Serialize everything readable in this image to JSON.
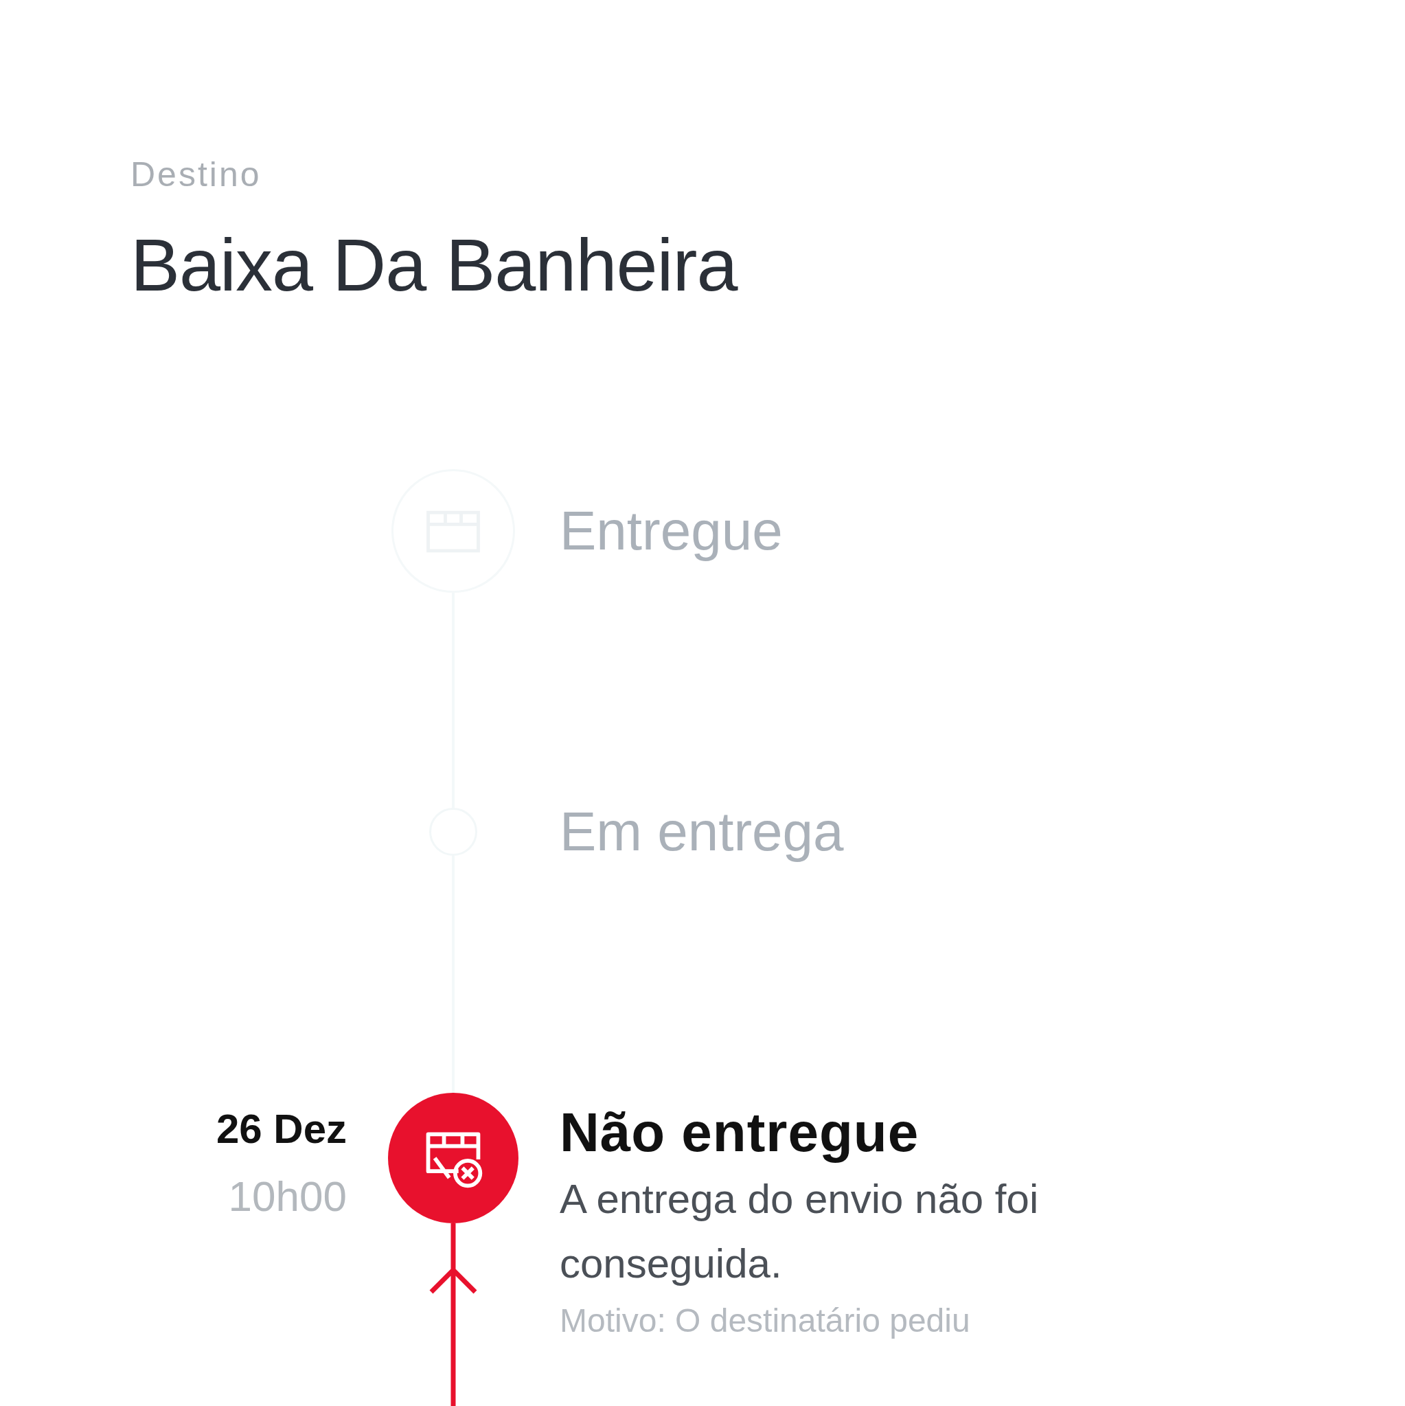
{
  "destination": {
    "label": "Destino",
    "name": "Baixa Da Banheira"
  },
  "timeline": [
    {
      "kind": "milestone",
      "title": "Entregue"
    },
    {
      "kind": "dot",
      "title": "Em entrega"
    },
    {
      "kind": "failed",
      "date": "26 Dez",
      "time": "10h00",
      "title": "Não entregue",
      "description": "A entrega do envio não foi conseguida.",
      "reason": "Motivo: O destinatário pediu"
    }
  ]
}
